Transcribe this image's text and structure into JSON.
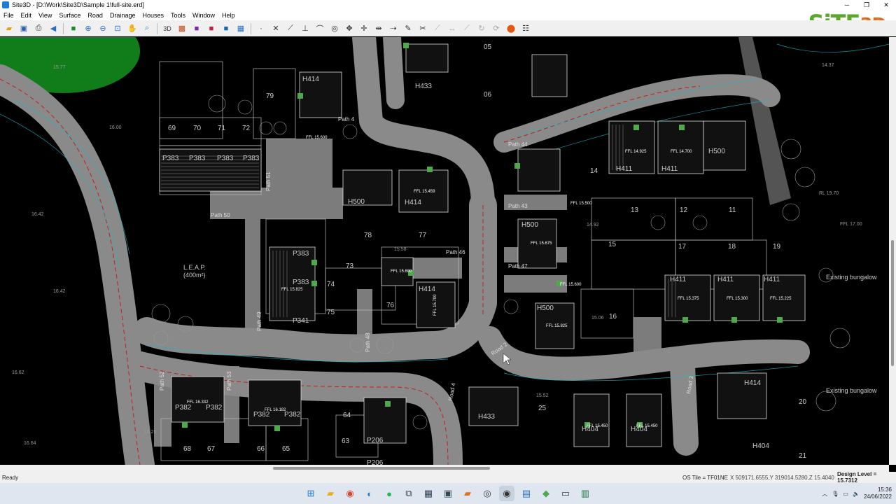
{
  "window": {
    "title": "Site3D - [D:\\Work\\Site3D\\Sample 1\\full-site.erd]",
    "minimize": "─",
    "maximize": "❐",
    "close": "✕"
  },
  "logo": {
    "part1": "SiTE",
    "part2": "3D"
  },
  "menu": [
    "File",
    "Edit",
    "View",
    "Surface",
    "Road",
    "Drainage",
    "Houses",
    "Tools",
    "Window",
    "Help"
  ],
  "drawing": {
    "plot_numbers": [
      "79",
      "69",
      "70",
      "71",
      "72",
      "78",
      "77",
      "74",
      "75",
      "76",
      "73",
      "68",
      "67",
      "66",
      "65",
      "63",
      "64",
      "14",
      "13",
      "12",
      "11",
      "15",
      "16",
      "17",
      "18",
      "19",
      "20",
      "25",
      "21",
      "05",
      "06"
    ],
    "house_types": [
      "H414",
      "H433",
      "P383",
      "P383",
      "P383",
      "P383",
      "H500",
      "H414",
      "H411",
      "H411",
      "H500",
      "H500",
      "P383",
      "P383",
      "H414",
      "H500",
      "H411",
      "H411",
      "H411",
      "P382",
      "P382",
      "P382",
      "P382",
      "H404",
      "H404",
      "H404",
      "H414",
      "P341",
      "P206",
      "P206",
      "H433"
    ],
    "path_labels": [
      "Path 44",
      "Path 43",
      "Path 47",
      "Path 46",
      "Path 50",
      "Path 51",
      "Path 49",
      "Path 48",
      "Path 52",
      "Path 53",
      "Path 4"
    ],
    "road_labels": [
      "Road 2",
      "Road 3",
      "Road 4"
    ],
    "ffl_labels": [
      "FFL 15.600",
      "FFL 15.459",
      "FFL 15.500",
      "FFL 15.675",
      "FFL 15.600",
      "FFL 15.825",
      "FFL 15.700",
      "FFL 15.825",
      "FFL 14.925",
      "FFL 14.700",
      "FFL 15.375",
      "FFL 15.300",
      "FFL 15.225",
      "FFL 15.600",
      "FFL 15.450",
      "FFL 15.450",
      "FFL 16.332",
      "FFL 16.182"
    ],
    "other_labels": [
      "L.E.A.P.",
      "(400m²)",
      "Existing bungalow",
      "Existing bungalow",
      "RL 19.70",
      "FFL 17.00",
      "14.92",
      "15.06",
      "15.58",
      "16.42",
      "16.62",
      "16.64",
      "16.26",
      "15.77",
      "16.00",
      "16.42",
      "15.52",
      "14.37"
    ]
  },
  "status": {
    "ready": "Ready",
    "os_tile": "OS Tile = TF01NE",
    "coords": "X 509171.6555,Y 319014.5280,Z 15.4040",
    "design_level": "Design Level = 15.7312"
  },
  "taskbar": {
    "time": "15:36",
    "date": "24/06/2022"
  }
}
